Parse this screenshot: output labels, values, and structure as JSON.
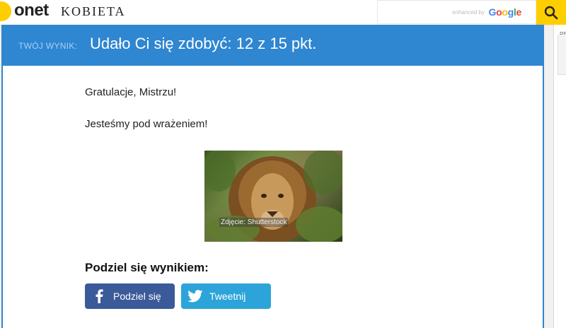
{
  "header": {
    "logo_main": "onet",
    "logo_section": "KOBIETA",
    "search": {
      "enhanced_label": "enhanced by",
      "google_label": "Google",
      "button_icon": "search-icon"
    }
  },
  "sidebar": {
    "label": "RE"
  },
  "result": {
    "label": "TWÓJ WYNIK:",
    "score_text": "Udało Ci się zdobyć: 12 z 15 pkt."
  },
  "message": {
    "line1": "Gratulacje, Mistrzu!",
    "line2": "Jesteśmy pod wrażeniem!"
  },
  "photo": {
    "subject": "lion",
    "credit": "Zdjęcie: Shutterstock"
  },
  "share": {
    "title": "Podziel się wynikiem:",
    "facebook_label": "Podziel się",
    "facebook_icon": "facebook-icon",
    "twitter_label": "Tweetnij",
    "twitter_icon": "twitter-icon"
  },
  "colors": {
    "accent_blue": "#2f86d1",
    "brand_yellow": "#ffce00",
    "facebook": "#3b5a99",
    "twitter": "#2ca4d9"
  }
}
